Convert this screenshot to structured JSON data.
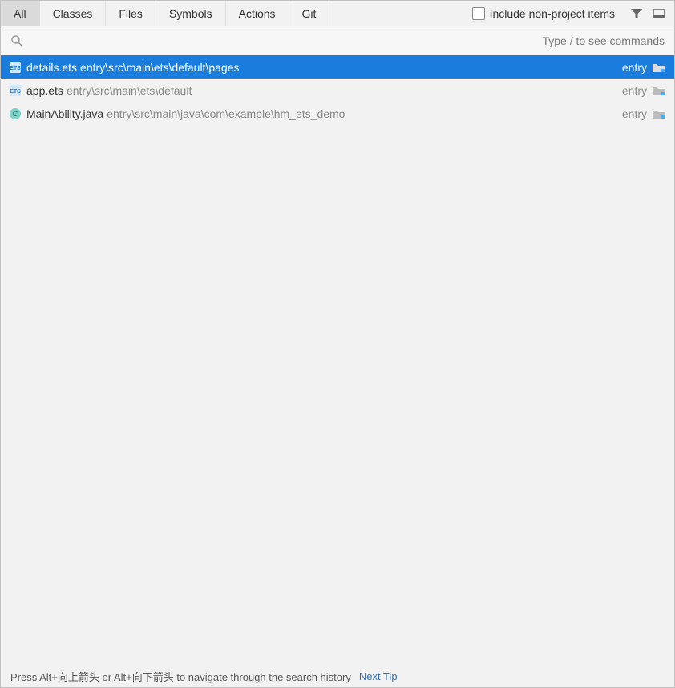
{
  "tabs": {
    "all": "All",
    "classes": "Classes",
    "files": "Files",
    "symbols": "Symbols",
    "actions": "Actions",
    "git": "Git"
  },
  "include_checkbox": "Include non-project items",
  "search_placeholder": "Type / to see commands",
  "results": [
    {
      "name": "details.ets",
      "path": "entry\\src\\main\\ets\\default\\pages",
      "module": "entry",
      "type": "ets",
      "selected": true
    },
    {
      "name": "app.ets",
      "path": "entry\\src\\main\\ets\\default",
      "module": "entry",
      "type": "ets",
      "selected": false
    },
    {
      "name": "MainAbility.java",
      "path": "entry\\src\\main\\java\\com\\example\\hm_ets_demo",
      "module": "entry",
      "type": "java",
      "selected": false
    }
  ],
  "footer": {
    "hint": "Press Alt+向上箭头 or Alt+向下箭头 to navigate through the search history",
    "link": "Next Tip"
  },
  "icons": {
    "filter": "filter-icon",
    "window": "window-icon",
    "search": "search-icon",
    "folder": "folder-icon"
  }
}
